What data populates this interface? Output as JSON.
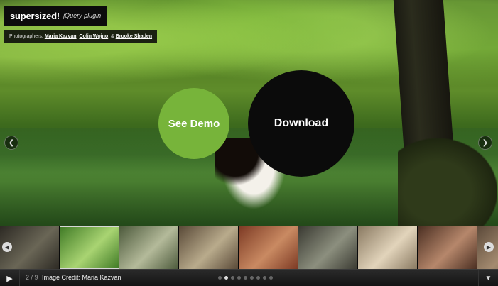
{
  "brand": {
    "name": "supersized",
    "mark": "!",
    "tagline": "jQuery plugin"
  },
  "credits": {
    "prefix": "Photographers:",
    "names": [
      "Maria Kazvan",
      "Colin Wojno",
      "Brooke Shaden"
    ],
    "sep1": ",",
    "sep2": ", &"
  },
  "actions": {
    "demo_label": "See Demo",
    "download_label": "Download"
  },
  "nav": {
    "prev_icon": "chevron-left-icon",
    "next_icon": "chevron-right-icon"
  },
  "thumbnails": [
    {
      "name": "tunnel-forest",
      "colors": [
        "#2d2a24",
        "#6a6656"
      ]
    },
    {
      "name": "couple-pond",
      "colors": [
        "#3f7a25",
        "#a9d472"
      ]
    },
    {
      "name": "bench-park",
      "colors": [
        "#4d5a3c",
        "#b4ba9a"
      ]
    },
    {
      "name": "tree-cone",
      "colors": [
        "#5a4a38",
        "#b9ab8c"
      ]
    },
    {
      "name": "brick-wall",
      "colors": [
        "#7d3a24",
        "#c98a62"
      ]
    },
    {
      "name": "stone-bridge",
      "colors": [
        "#3a3a32",
        "#8c8f7e"
      ]
    },
    {
      "name": "portrait-bed",
      "colors": [
        "#8a7a62",
        "#e2d4bb"
      ]
    },
    {
      "name": "girl-sitting",
      "colors": [
        "#4b2f22",
        "#b6876b"
      ]
    },
    {
      "name": "street-scene",
      "colors": [
        "#5c4a3a",
        "#a48b70"
      ]
    }
  ],
  "control": {
    "counter": "2 / 9",
    "caption": "Image Credit: Maria Kazvan",
    "dot_count": 9,
    "active_index": 1
  },
  "colors": {
    "demo_circle": "#77b43a",
    "download_circle": "#0b0b0b"
  }
}
